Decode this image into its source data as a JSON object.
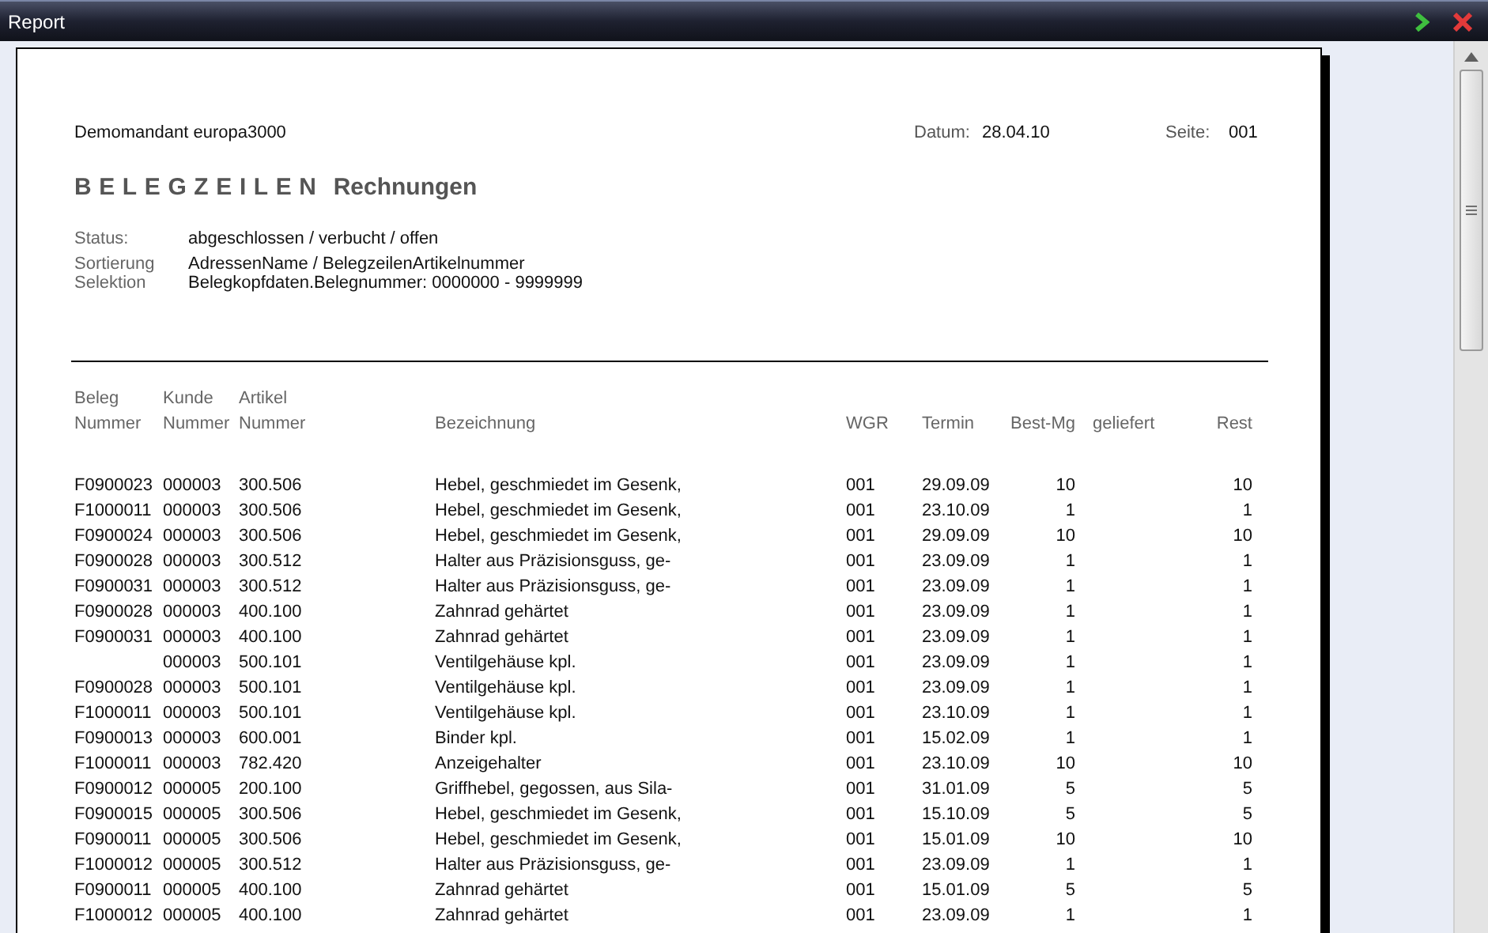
{
  "window": {
    "title": "Report"
  },
  "report": {
    "company": "Demomandant europa3000",
    "date_label": "Datum:",
    "date": "28.04.10",
    "page_label": "Seite:",
    "page": "001",
    "title_spaced": "BELEGZEILEN",
    "title": "Rechnungen",
    "criteria": [
      {
        "label": "Status:",
        "value": "abgeschlossen / verbucht / offen"
      },
      {
        "label": "Sortierung",
        "value": "AdressenName / BelegzeilenArtikelnummer"
      },
      {
        "label": "Selektion",
        "value": "Belegkopfdaten.Belegnummer: 0000000 - 9999999"
      }
    ]
  },
  "table": {
    "columns": [
      {
        "top": "Beleg",
        "label": "Nummer"
      },
      {
        "top": "Kunde",
        "label": "Nummer"
      },
      {
        "top": "Artikel",
        "label": "Nummer"
      },
      {
        "label": "Bezeichnung"
      },
      {
        "label": "WGR"
      },
      {
        "label": "Termin"
      },
      {
        "label": "Best-Mg"
      },
      {
        "label": "geliefert"
      },
      {
        "label": "Rest"
      }
    ],
    "rows": [
      {
        "beleg": "F0900023",
        "kunde": "000003",
        "artikel": "300.506",
        "bezeichnung": "Hebel, geschmiedet im Gesenk,",
        "wgr": "001",
        "termin": "29.09.09",
        "best_mg": "10",
        "rest": "10"
      },
      {
        "beleg": "F1000011",
        "kunde": "000003",
        "artikel": "300.506",
        "bezeichnung": "Hebel, geschmiedet im Gesenk,",
        "wgr": "001",
        "termin": "23.10.09",
        "best_mg": "1",
        "rest": "1"
      },
      {
        "beleg": "F0900024",
        "kunde": "000003",
        "artikel": "300.506",
        "bezeichnung": "Hebel, geschmiedet im Gesenk,",
        "wgr": "001",
        "termin": "29.09.09",
        "best_mg": "10",
        "rest": "10"
      },
      {
        "beleg": "F0900028",
        "kunde": "000003",
        "artikel": "300.512",
        "bezeichnung": "Halter aus Präzisionsguss, ge-",
        "wgr": "001",
        "termin": "23.09.09",
        "best_mg": "1",
        "rest": "1"
      },
      {
        "beleg": "F0900031",
        "kunde": "000003",
        "artikel": "300.512",
        "bezeichnung": "Halter aus Präzisionsguss, ge-",
        "wgr": "001",
        "termin": "23.09.09",
        "best_mg": "1",
        "rest": "1"
      },
      {
        "beleg": "F0900028",
        "kunde": "000003",
        "artikel": "400.100",
        "bezeichnung": "Zahnrad gehärtet",
        "wgr": "001",
        "termin": "23.09.09",
        "best_mg": "1",
        "rest": "1"
      },
      {
        "beleg": "F0900031",
        "kunde": "000003",
        "artikel": "400.100",
        "bezeichnung": "Zahnrad gehärtet",
        "wgr": "001",
        "termin": "23.09.09",
        "best_mg": "1",
        "rest": "1"
      },
      {
        "kunde": "000003",
        "artikel": "500.101",
        "bezeichnung": "Ventilgehäuse kpl.",
        "wgr": "001",
        "termin": "23.09.09",
        "best_mg": "1",
        "rest": "1"
      },
      {
        "beleg": "F0900028",
        "kunde": "000003",
        "artikel": "500.101",
        "bezeichnung": "Ventilgehäuse kpl.",
        "wgr": "001",
        "termin": "23.09.09",
        "best_mg": "1",
        "rest": "1"
      },
      {
        "beleg": "F1000011",
        "kunde": "000003",
        "artikel": "500.101",
        "bezeichnung": "Ventilgehäuse kpl.",
        "wgr": "001",
        "termin": "23.10.09",
        "best_mg": "1",
        "rest": "1"
      },
      {
        "beleg": "F0900013",
        "kunde": "000003",
        "artikel": "600.001",
        "bezeichnung": "Binder kpl.",
        "wgr": "001",
        "termin": "15.02.09",
        "best_mg": "1",
        "rest": "1"
      },
      {
        "beleg": "F1000011",
        "kunde": "000003",
        "artikel": "782.420",
        "bezeichnung": "Anzeigehalter",
        "wgr": "001",
        "termin": "23.10.09",
        "best_mg": "10",
        "rest": "10"
      },
      {
        "beleg": "F0900012",
        "kunde": "000005",
        "artikel": "200.100",
        "bezeichnung": "Griffhebel, gegossen, aus Sila-",
        "wgr": "001",
        "termin": "31.01.09",
        "best_mg": "5",
        "rest": "5"
      },
      {
        "beleg": "F0900015",
        "kunde": "000005",
        "artikel": "300.506",
        "bezeichnung": "Hebel, geschmiedet im Gesenk,",
        "wgr": "001",
        "termin": "15.10.09",
        "best_mg": "5",
        "rest": "5"
      },
      {
        "beleg": "F0900011",
        "kunde": "000005",
        "artikel": "300.506",
        "bezeichnung": "Hebel, geschmiedet im Gesenk,",
        "wgr": "001",
        "termin": "15.01.09",
        "best_mg": "10",
        "rest": "10"
      },
      {
        "beleg": "F1000012",
        "kunde": "000005",
        "artikel": "300.512",
        "bezeichnung": "Halter aus Präzisionsguss, ge-",
        "wgr": "001",
        "termin": "23.09.09",
        "best_mg": "1",
        "rest": "1"
      },
      {
        "beleg": "F0900011",
        "kunde": "000005",
        "artikel": "400.100",
        "bezeichnung": "Zahnrad gehärtet",
        "wgr": "001",
        "termin": "15.01.09",
        "best_mg": "5",
        "rest": "5"
      },
      {
        "beleg": "F1000012",
        "kunde": "000005",
        "artikel": "400.100",
        "bezeichnung": "Zahnrad gehärtet",
        "wgr": "001",
        "termin": "23.09.09",
        "best_mg": "1",
        "rest": "1"
      }
    ]
  }
}
